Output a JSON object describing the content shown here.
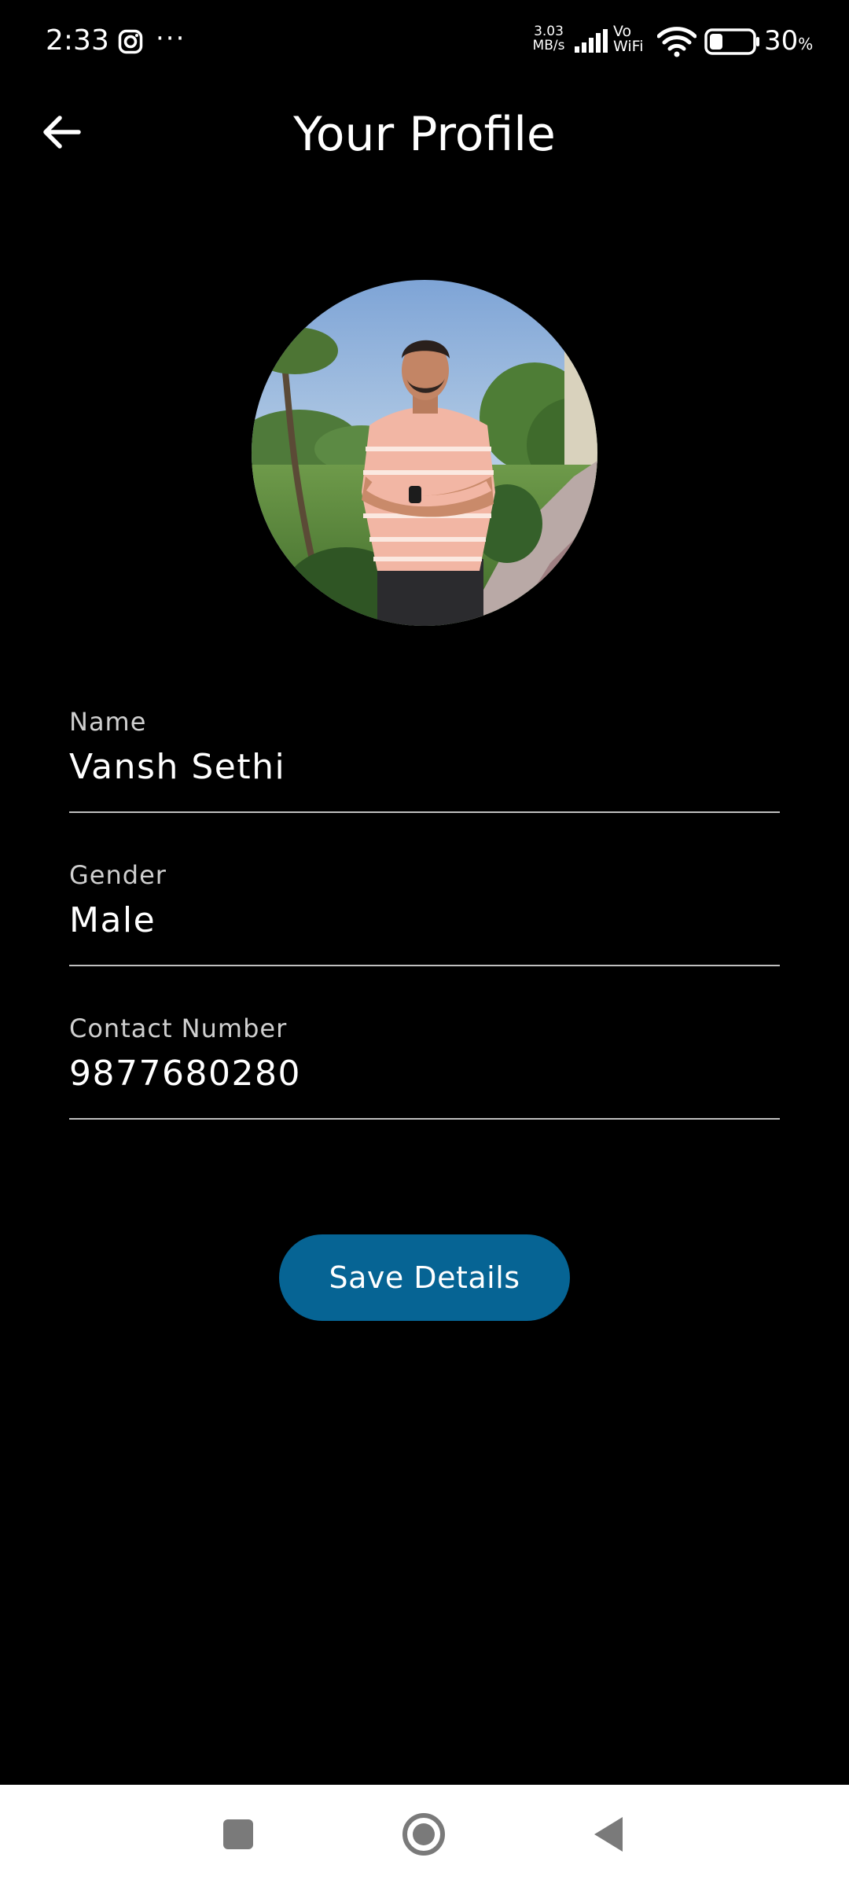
{
  "status_bar": {
    "time": "2:33",
    "overflow_dots": "···",
    "network_speed_value": "3.03",
    "network_speed_unit": "MB/s",
    "vo_label": "Vo",
    "wifi_label": "WiFi",
    "battery_percent": "30",
    "battery_percent_sign": "%",
    "battery_level": 0.3,
    "icons": [
      "instagram-icon",
      "signal-icon",
      "wifi-icon",
      "battery-icon"
    ]
  },
  "header": {
    "title": "Your Profile",
    "back_icon": "arrow-left-icon"
  },
  "profile": {
    "avatar_icon": "profile-photo"
  },
  "form": {
    "name": {
      "label": "Name",
      "value": "Vansh Sethi"
    },
    "gender": {
      "label": "Gender",
      "value": "Male"
    },
    "contact": {
      "label": "Contact Number",
      "value": "9877680280"
    }
  },
  "actions": {
    "save_label": "Save Details"
  },
  "nav_bar": {
    "items": [
      "recents-icon",
      "home-icon",
      "back-triangle-icon"
    ]
  },
  "colors": {
    "background": "#000000",
    "primary_button": "#066494",
    "text": "#ffffff",
    "field_underline": "#bfbfbf",
    "nav_background": "#ffffff",
    "nav_icons": "#7a7a7a"
  }
}
